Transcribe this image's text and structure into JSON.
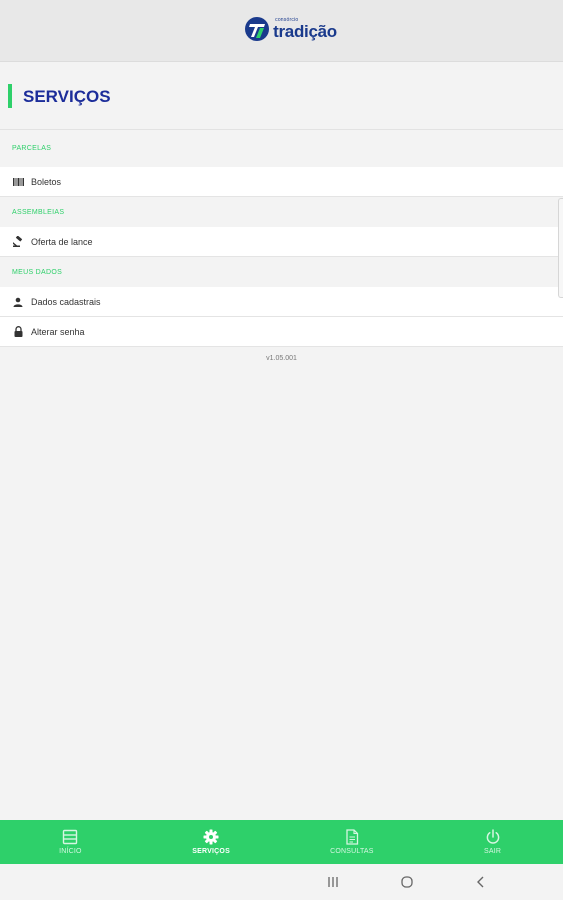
{
  "header": {
    "logo_small_text": "consórcio",
    "logo_brand": "tradição",
    "logo_icon": "tradicao-logo-icon"
  },
  "page": {
    "title": "SERVIÇOS"
  },
  "sections": [
    {
      "header": "PARCELAS",
      "items": [
        {
          "label": "Boletos",
          "icon": "barcode-icon"
        }
      ]
    },
    {
      "header": "ASSEMBLEIAS",
      "items": [
        {
          "label": "Oferta de lance",
          "icon": "gavel-icon"
        }
      ]
    },
    {
      "header": "MEUS DADOS",
      "items": [
        {
          "label": "Dados cadastrais",
          "icon": "person-icon"
        },
        {
          "label": "Alterar senha",
          "icon": "lock-icon"
        }
      ]
    }
  ],
  "version": "v1.05.001",
  "bottom_nav": [
    {
      "label": "INÍCIO",
      "icon": "home-icon",
      "active": false
    },
    {
      "label": "SERVIÇOS",
      "icon": "gear-icon",
      "active": true
    },
    {
      "label": "CONSULTAS",
      "icon": "document-icon",
      "active": false
    },
    {
      "label": "SAIR",
      "icon": "power-icon",
      "active": false
    }
  ],
  "system_nav": {
    "recents_icon": "recents-icon",
    "home_icon": "home-circle-icon",
    "back_icon": "back-icon"
  },
  "colors": {
    "accent_green": "#2ed06a",
    "brand_blue": "#1c2d9a"
  }
}
